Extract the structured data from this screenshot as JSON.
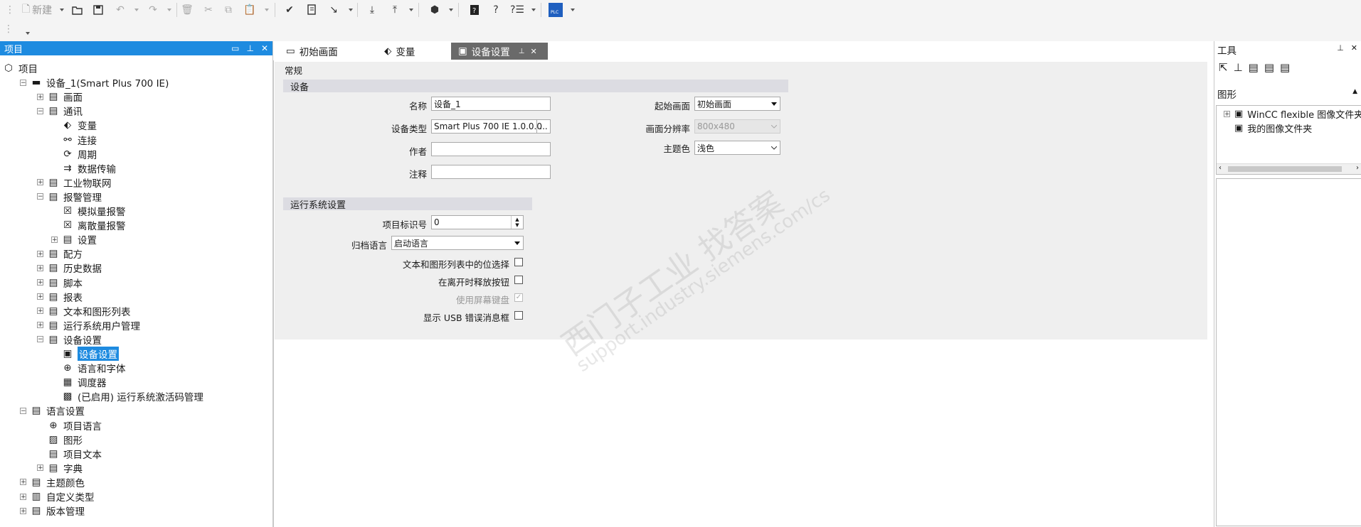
{
  "toolbar": {
    "new_label": "新建"
  },
  "project_panel": {
    "title": "项目",
    "tree": [
      {
        "label": "项目",
        "level": 0,
        "expander": "",
        "icon": "cube-icon"
      },
      {
        "label": "设备_1(Smart Plus 700 IE)",
        "level": 1,
        "expander": "-",
        "icon": "hmi-device-icon"
      },
      {
        "label": "画面",
        "level": 2,
        "expander": "+",
        "icon": "folder-icon"
      },
      {
        "label": "通讯",
        "level": 2,
        "expander": "-",
        "icon": "folder-icon"
      },
      {
        "label": "变量",
        "level": 3,
        "expander": "",
        "icon": "tag-icon"
      },
      {
        "label": "连接",
        "level": 3,
        "expander": "",
        "icon": "connection-icon"
      },
      {
        "label": "周期",
        "level": 3,
        "expander": "",
        "icon": "cycle-icon"
      },
      {
        "label": "数据传输",
        "level": 3,
        "expander": "",
        "icon": "data-transfer-icon"
      },
      {
        "label": "工业物联网",
        "level": 2,
        "expander": "+",
        "icon": "folder-icon"
      },
      {
        "label": "报警管理",
        "level": 2,
        "expander": "-",
        "icon": "folder-icon"
      },
      {
        "label": "模拟量报警",
        "level": 3,
        "expander": "",
        "icon": "alarm-icon"
      },
      {
        "label": "离散量报警",
        "level": 3,
        "expander": "",
        "icon": "alarm-icon"
      },
      {
        "label": "设置",
        "level": 3,
        "expander": "+",
        "icon": "folder-icon"
      },
      {
        "label": "配方",
        "level": 2,
        "expander": "+",
        "icon": "folder-icon"
      },
      {
        "label": "历史数据",
        "level": 2,
        "expander": "+",
        "icon": "folder-icon"
      },
      {
        "label": "脚本",
        "level": 2,
        "expander": "+",
        "icon": "folder-icon"
      },
      {
        "label": "报表",
        "level": 2,
        "expander": "+",
        "icon": "folder-icon"
      },
      {
        "label": "文本和图形列表",
        "level": 2,
        "expander": "+",
        "icon": "folder-icon"
      },
      {
        "label": "运行系统用户管理",
        "level": 2,
        "expander": "+",
        "icon": "folder-icon"
      },
      {
        "label": "设备设置",
        "level": 2,
        "expander": "-",
        "icon": "folder-icon"
      },
      {
        "label": "设备设置",
        "level": 3,
        "expander": "",
        "icon": "device-settings-icon",
        "selected": true
      },
      {
        "label": "语言和字体",
        "level": 3,
        "expander": "",
        "icon": "globe-icon"
      },
      {
        "label": "调度器",
        "level": 3,
        "expander": "",
        "icon": "scheduler-icon"
      },
      {
        "label": "(已启用)  运行系统激活码管理",
        "level": 3,
        "expander": "",
        "icon": "license-icon"
      },
      {
        "label": "语言设置",
        "level": 1,
        "expander": "-",
        "icon": "folder-icon"
      },
      {
        "label": "项目语言",
        "level": 2,
        "expander": "",
        "icon": "globe-icon"
      },
      {
        "label": "图形",
        "level": 2,
        "expander": "",
        "icon": "image-icon"
      },
      {
        "label": "项目文本",
        "level": 2,
        "expander": "",
        "icon": "document-icon"
      },
      {
        "label": "字典",
        "level": 2,
        "expander": "+",
        "icon": "folder-icon"
      },
      {
        "label": "主题颜色",
        "level": 1,
        "expander": "+",
        "icon": "folder-icon"
      },
      {
        "label": "自定义类型",
        "level": 1,
        "expander": "+",
        "icon": "udt-icon"
      },
      {
        "label": "版本管理",
        "level": 1,
        "expander": "+",
        "icon": "folder-icon"
      }
    ]
  },
  "tabs": [
    {
      "label": "初始画面",
      "icon": "screen-icon",
      "active": false
    },
    {
      "label": "变量",
      "icon": "tag-icon",
      "active": false
    },
    {
      "label": "设备设置",
      "icon": "device-settings-icon",
      "active": true
    }
  ],
  "settings": {
    "general_label": "常规",
    "device_section": "设备",
    "name_label": "名称",
    "name_value": "设备_1",
    "device_type_label": "设备类型",
    "device_type_value": "Smart Plus 700 IE 1.0.0.0",
    "author_label": "作者",
    "author_value": "",
    "comment_label": "注释",
    "comment_value": "",
    "start_screen_label": "起始画面",
    "start_screen_value": "初始画面",
    "resolution_label": "画面分辨率",
    "resolution_value": "800x480",
    "theme_label": "主题色",
    "theme_value": "浅色",
    "runtime_section": "运行系统设置",
    "project_id_label": "项目标识号",
    "project_id_value": "0",
    "archive_lang_label": "归档语言",
    "archive_lang_value": "启动语言",
    "text_graphic_label": "文本和图形列表中的位选择",
    "text_graphic_checked": false,
    "release_button_label": "在离开时释放按钮",
    "release_button_checked": false,
    "screen_keyboard_label": "使用屏幕键盘",
    "screen_keyboard_checked": true,
    "usb_error_label": "显示 USB 错误消息框",
    "usb_error_checked": false,
    "more_button": "..."
  },
  "tools_panel": {
    "title": "工具",
    "graphics_label": "图形",
    "items": [
      {
        "label": "WinCC flexible 图像文件夹",
        "expander": "+"
      },
      {
        "label": "我的图像文件夹",
        "expander": ""
      }
    ]
  },
  "watermark": {
    "line1": "西门子工业   找答案",
    "line2": "support.industry.siemens.com/cs"
  },
  "colors": {
    "accent": "#1e8be0",
    "active_tab": "#6a6a6a"
  }
}
